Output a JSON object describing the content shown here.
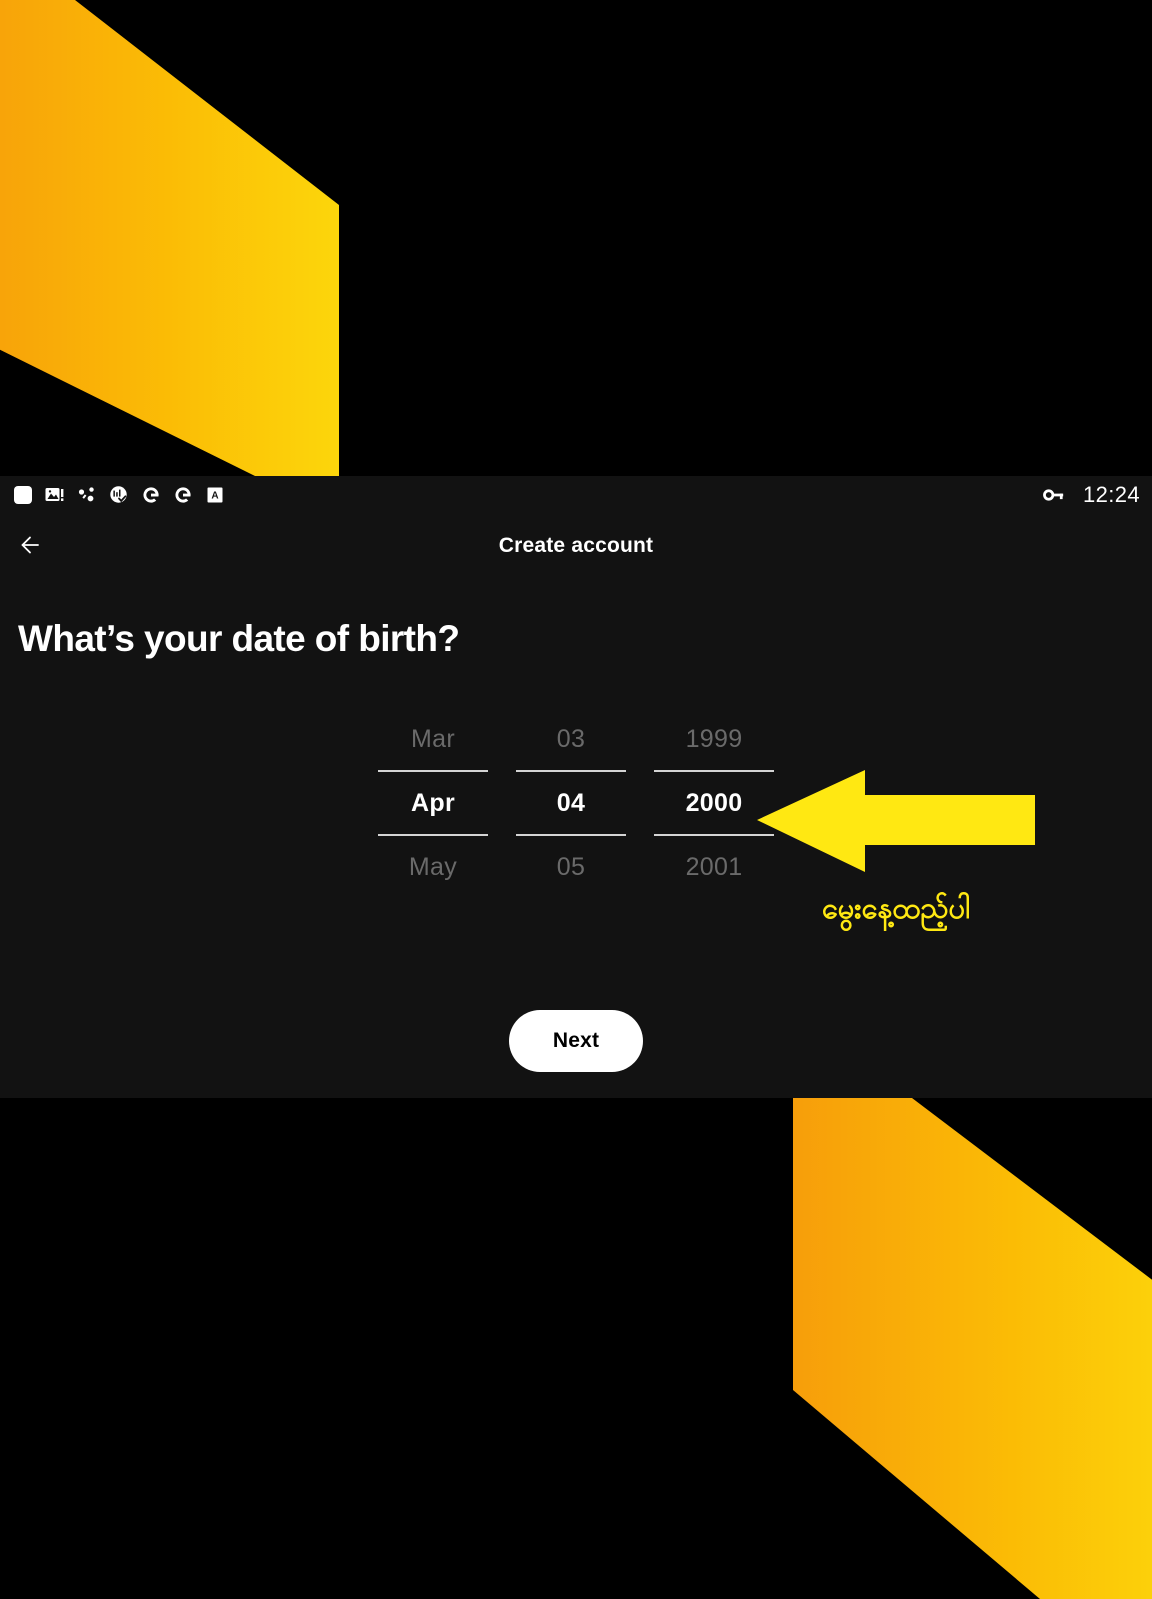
{
  "background": {
    "page_color": "#000000",
    "shape_gradient_from": "#f79e0a",
    "shape_gradient_to": "#fcd60b"
  },
  "status_bar": {
    "icons": [
      "rounded-square-icon",
      "image-alert-icon",
      "share-nodes-icon",
      "clock-check-icon",
      "google-g-icon",
      "google-g-icon",
      "a-box-icon"
    ],
    "vpn_icon": "key-icon",
    "time": "12:24"
  },
  "header": {
    "back_icon": "arrow-left-icon",
    "title": "Create account"
  },
  "main": {
    "headline": "What’s your date of birth?",
    "next_label": "Next"
  },
  "date_picker": {
    "columns": [
      {
        "name": "month",
        "previous": "Mar",
        "selected": "Apr",
        "next": "May"
      },
      {
        "name": "day",
        "previous": "03",
        "selected": "04",
        "next": "05"
      },
      {
        "name": "year",
        "previous": "1999",
        "selected": "2000",
        "next": "2001"
      }
    ]
  },
  "annotation": {
    "arrow_icon": "arrow-left-pointer-icon",
    "arrow_color": "#ffe812",
    "text": "မွေးနေ့ထည့်ပါ",
    "text_color": "#ffe812"
  }
}
